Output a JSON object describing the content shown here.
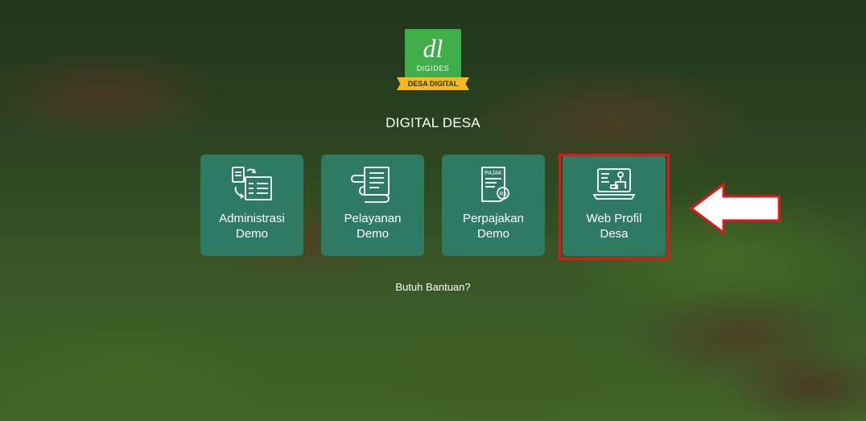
{
  "logo": {
    "glyph": "dl",
    "name": "DIGIDES",
    "ribbon": "DESA DIGITAL"
  },
  "page": {
    "title": "DIGITAL DESA",
    "help_link": "Butuh Bantuan?"
  },
  "cards": [
    {
      "line1": "Administrasi",
      "line2": "Demo",
      "icon": "documents-transfer-icon"
    },
    {
      "line1": "Pelayanan",
      "line2": "Demo",
      "icon": "scroll-document-icon"
    },
    {
      "line1": "Perpajakan",
      "line2": "Demo",
      "icon": "tax-receipt-icon",
      "icon_text": "PAJAK",
      "icon_badge": "Rp"
    },
    {
      "line1": "Web Profil",
      "line2": "Desa",
      "icon": "laptop-profile-icon"
    }
  ],
  "colors": {
    "card": "#2e7a63",
    "highlight": "#e0161b",
    "logo": "#3fae49",
    "ribbon": "#f6b81f"
  }
}
